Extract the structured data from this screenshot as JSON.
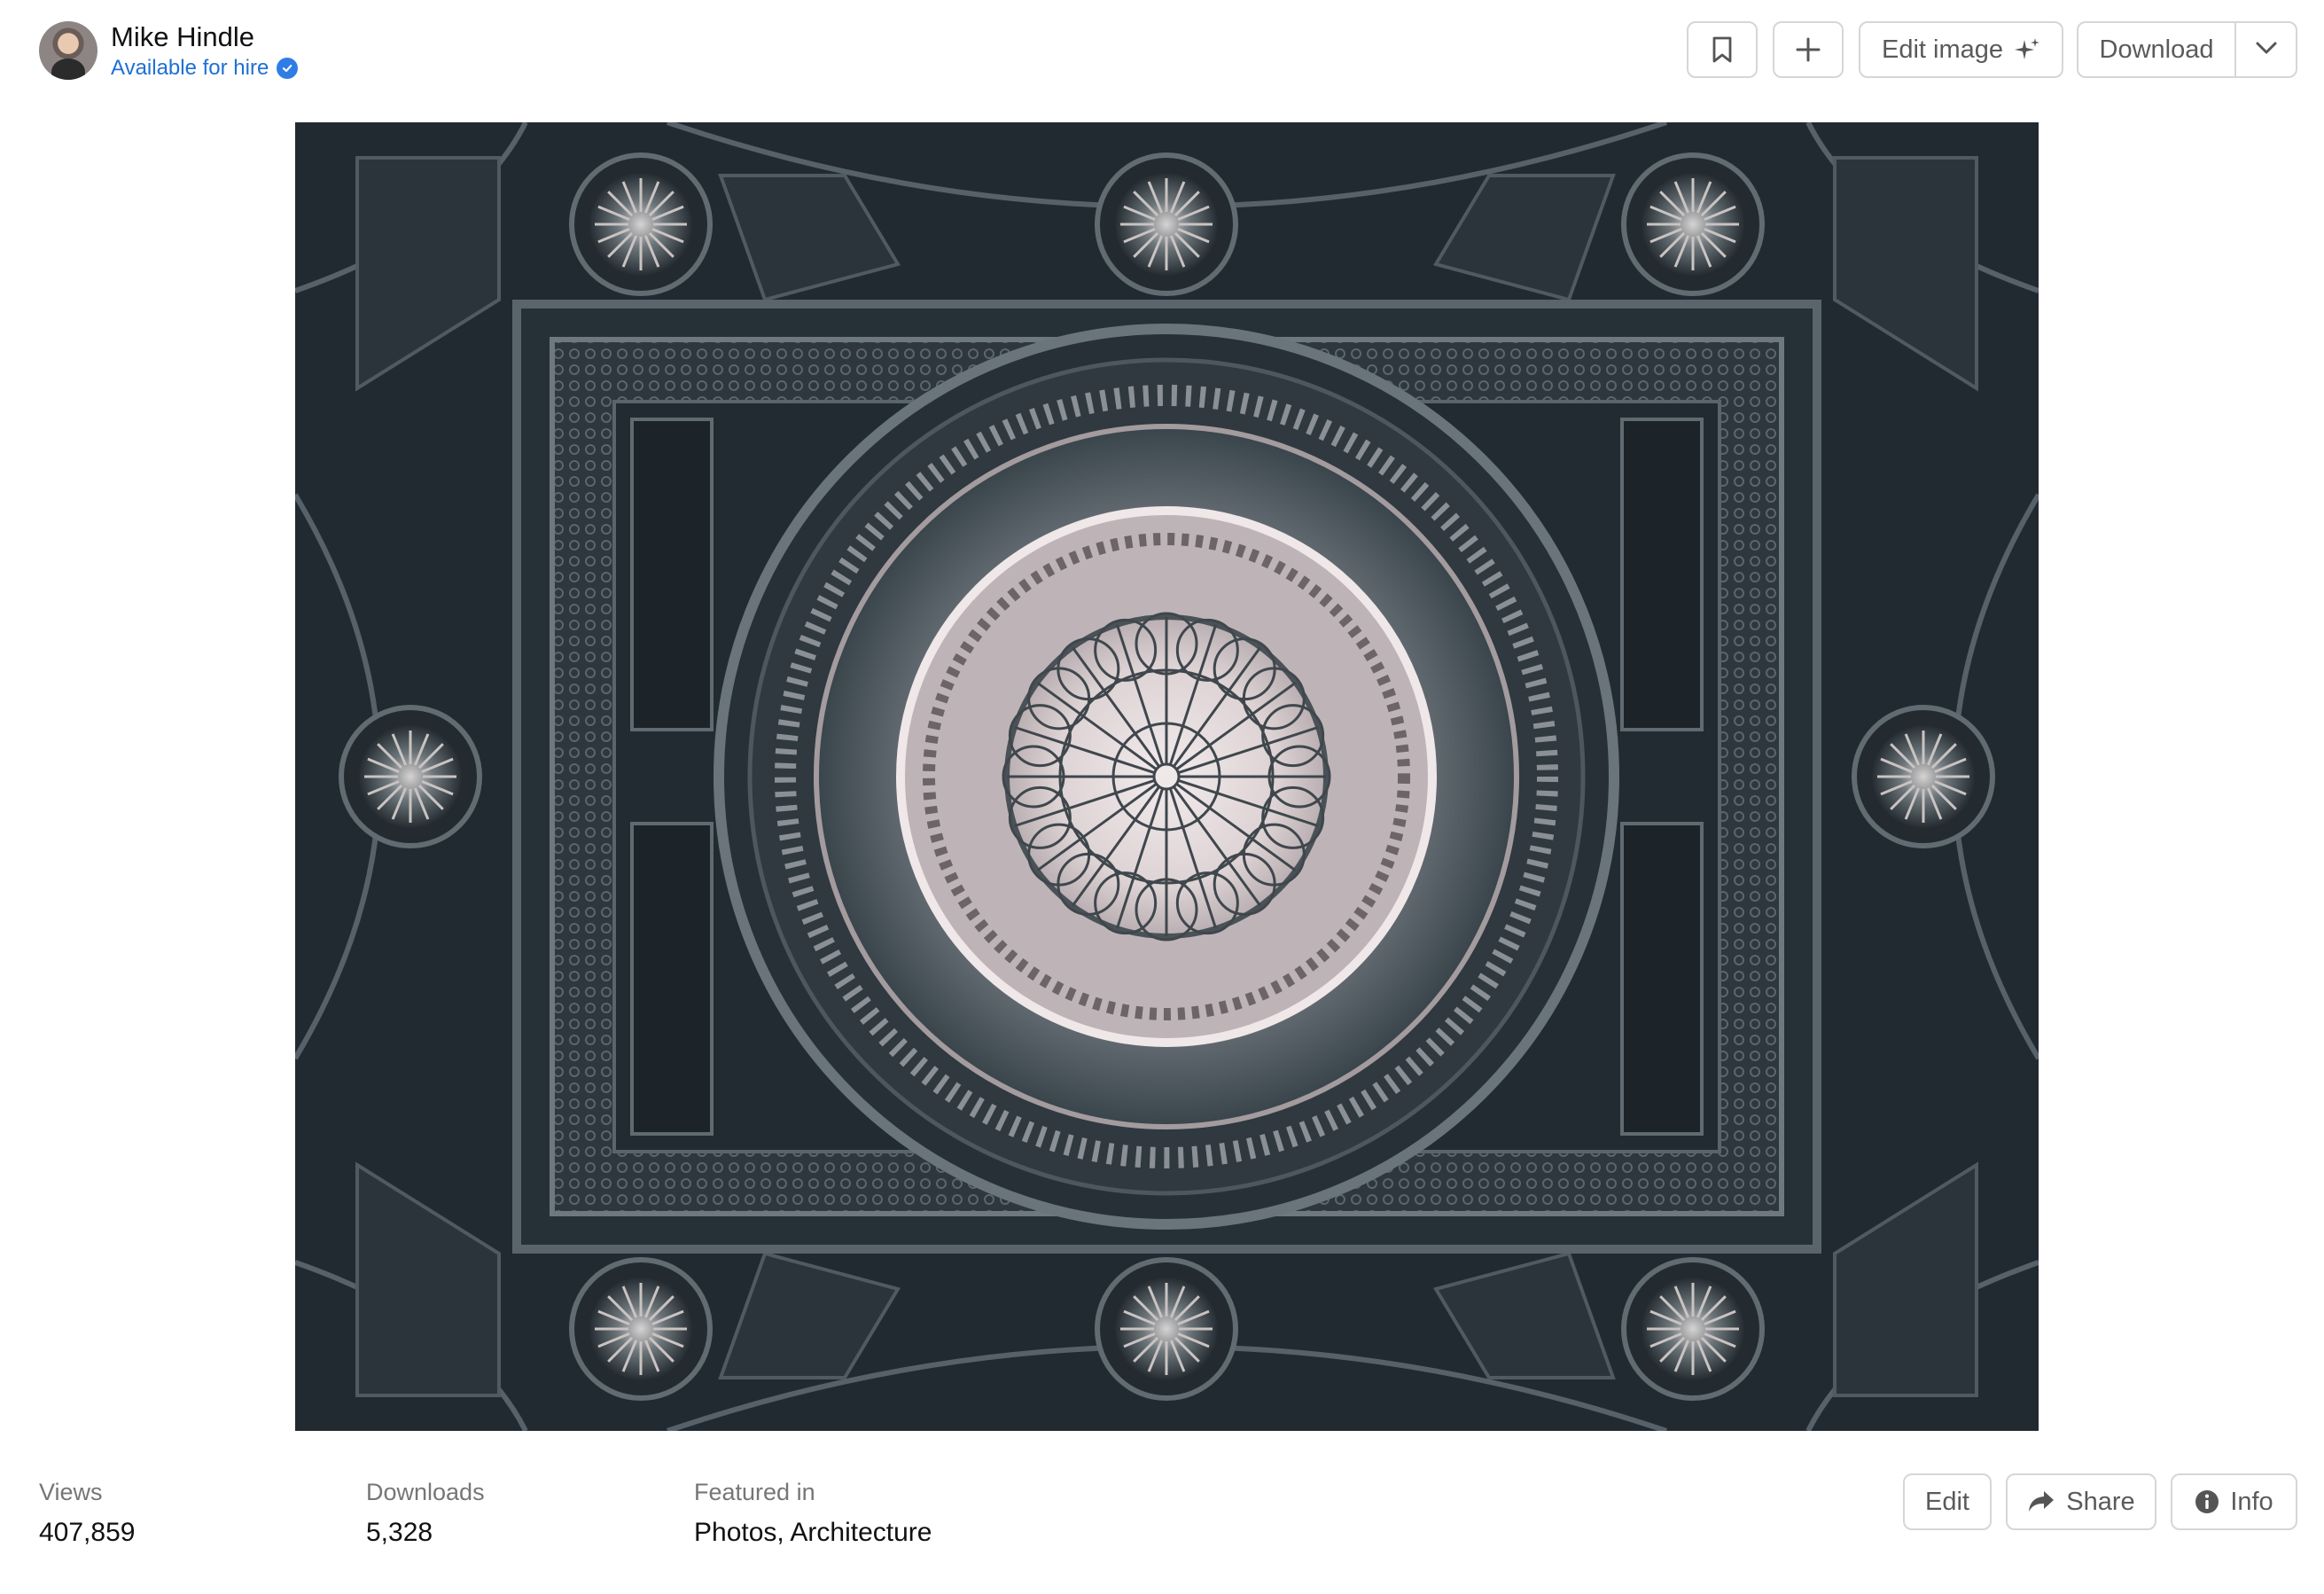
{
  "author": {
    "name": "Mike Hindle",
    "status": "Available for hire"
  },
  "toolbar": {
    "bookmark_icon": "bookmark-icon",
    "add_icon": "plus-icon",
    "edit_image_label": "Edit image",
    "download_label": "Download",
    "download_menu_icon": "chevron-down-icon"
  },
  "photo": {
    "subject": "ornate ceiling with circular skylight dome"
  },
  "stats": {
    "views_label": "Views",
    "views_value": "407,859",
    "downloads_label": "Downloads",
    "downloads_value": "5,328",
    "featured_label": "Featured in",
    "featured_items": [
      "Photos",
      "Architecture"
    ],
    "featured_separator": ", "
  },
  "actions": {
    "edit_label": "Edit",
    "share_label": "Share",
    "info_label": "Info"
  },
  "colors": {
    "accent": "#1f6fd6",
    "border": "#d6d6d6",
    "muted_text": "#767676"
  }
}
